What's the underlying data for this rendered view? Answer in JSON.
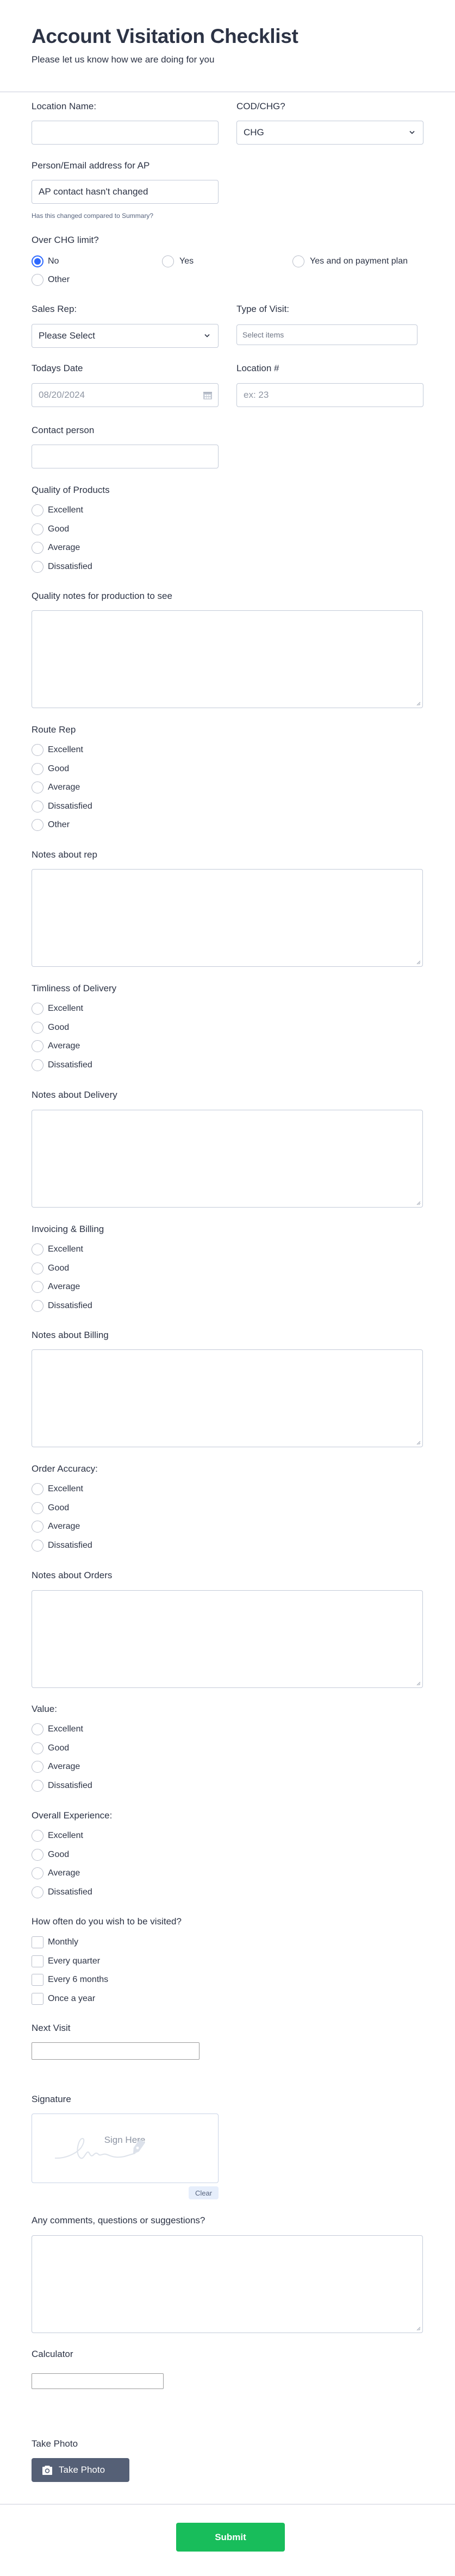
{
  "header": {
    "title": "Account Visitation Checklist",
    "subtitle": "Please let us know how we are doing for you"
  },
  "fields": {
    "location_name": {
      "label": "Location Name:",
      "value": ""
    },
    "cod_chg": {
      "label": "COD/CHG?",
      "value": "CHG"
    },
    "ap_contact": {
      "label": "Person/Email address for AP",
      "value": "AP contact hasn't changed",
      "hint": "Has this changed compared to Summary?"
    },
    "over_chg_limit": {
      "label": "Over CHG limit?",
      "options": [
        "No",
        "Yes",
        "Yes and on payment plan",
        "Other"
      ],
      "selected": "No"
    },
    "sales_rep": {
      "label": "Sales Rep:",
      "value": "Please Select"
    },
    "type_of_visit": {
      "label": "Type of Visit:",
      "placeholder": "Select items"
    },
    "todays_date": {
      "label": "Todays Date",
      "placeholder": "08/20/2024"
    },
    "location_number": {
      "label": "Location #",
      "placeholder": "ex: 23"
    },
    "contact_person": {
      "label": "Contact person",
      "value": ""
    }
  },
  "ratings": [
    {
      "label": "Quality of Products",
      "options": [
        "Excellent",
        "Good",
        "Average",
        "Dissatisfied"
      ]
    },
    {
      "label": "Route Rep",
      "options": [
        "Excellent",
        "Good",
        "Average",
        "Dissatisfied",
        "Other"
      ]
    },
    {
      "label": "Timliness of Delivery",
      "options": [
        "Excellent",
        "Good",
        "Average",
        "Dissatisfied"
      ]
    },
    {
      "label": "Invoicing & Billing",
      "options": [
        "Excellent",
        "Good",
        "Average",
        "Dissatisfied"
      ]
    },
    {
      "label": "Order Accuracy:",
      "options": [
        "Excellent",
        "Good",
        "Average",
        "Dissatisfied"
      ]
    },
    {
      "label": "Value:",
      "options": [
        "Excellent",
        "Good",
        "Average",
        "Dissatisfied"
      ]
    },
    {
      "label": "Overall Experience:",
      "options": [
        "Excellent",
        "Good",
        "Average",
        "Dissatisfied"
      ]
    }
  ],
  "notes": [
    {
      "label": "Quality notes for production to see",
      "value": ""
    },
    {
      "label": "Notes about rep",
      "value": ""
    },
    {
      "label": "Notes about Delivery",
      "value": ""
    },
    {
      "label": "Notes about Billing",
      "value": ""
    },
    {
      "label": "Notes about Orders",
      "value": ""
    }
  ],
  "visit_frequency": {
    "label": "How often do you wish to be visited?",
    "options": [
      "Monthly",
      "Every quarter",
      "Every 6 months",
      "Once a year"
    ]
  },
  "next_visit": {
    "label": "Next Visit",
    "value": ""
  },
  "signature": {
    "label": "Signature",
    "placeholder": "Sign Here",
    "clear_label": "Clear"
  },
  "comments": {
    "label": "Any comments, questions or suggestions?",
    "value": ""
  },
  "calculator": {
    "label": "Calculator",
    "value": ""
  },
  "photo": {
    "label": "Take Photo",
    "button_label": "Take Photo"
  },
  "submit": {
    "label": "Submit"
  },
  "colors": {
    "accent": "#2e69ff",
    "submit": "#18bd5b",
    "photo_button": "#556076",
    "text": "#2c3345"
  }
}
